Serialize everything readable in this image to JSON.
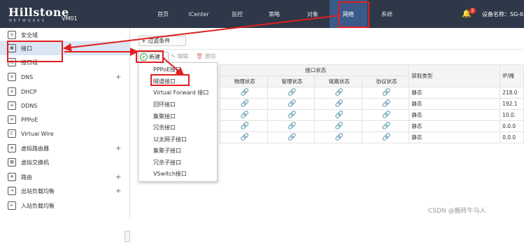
{
  "brand": {
    "logo": "Hillstone",
    "logo_sub": "NETWORKS",
    "device": "VM01"
  },
  "nav": [
    "首页",
    "iCenter",
    "监控",
    "策略",
    "对象",
    "网络",
    "系统"
  ],
  "notifications": {
    "count": "2"
  },
  "device_name": "设备名称：SG-6",
  "sidebar": [
    {
      "label": "安全域",
      "icon": "security-zone-icon",
      "plus": false
    },
    {
      "label": "接口",
      "icon": "interface-icon",
      "plus": false
    },
    {
      "label": "接口组",
      "icon": "interface-group-icon",
      "plus": false
    },
    {
      "label": "DNS",
      "icon": "dns-icon",
      "plus": true
    },
    {
      "label": "DHCP",
      "icon": "dhcp-icon",
      "plus": false
    },
    {
      "label": "DDNS",
      "icon": "ddns-icon",
      "plus": false
    },
    {
      "label": "PPPoE",
      "icon": "pppoe-icon",
      "plus": false
    },
    {
      "label": "Virtual Wire",
      "icon": "virtual-wire-icon",
      "plus": false
    },
    {
      "label": "虚拟路由器",
      "icon": "virtual-router-icon",
      "plus": true
    },
    {
      "label": "虚拟交换机",
      "icon": "virtual-switch-icon",
      "plus": false
    },
    {
      "label": "路由",
      "icon": "route-icon",
      "plus": true
    },
    {
      "label": "出站负载均衡",
      "icon": "outbound-lb-icon",
      "plus": true
    },
    {
      "label": "入站负载均衡",
      "icon": "inbound-lb-icon",
      "plus": false
    }
  ],
  "toolbar": {
    "filter": "过滤条件",
    "add": "新建",
    "edit": "编辑",
    "delete": "删除"
  },
  "table": {
    "group_header": "接口状态",
    "sub_headers": [
      "物理状态",
      "管理状态",
      "链路状态",
      "协议状态"
    ],
    "acquire_header": "获取类型",
    "ip_header": "IP/掩",
    "rows": [
      {
        "phys": "ok",
        "admin": "ok",
        "link": "ok",
        "proto": "ok",
        "acquire": "静态",
        "ip": "218.0"
      },
      {
        "phys": "ok",
        "admin": "ok",
        "link": "ok",
        "proto": "ok",
        "acquire": "静态",
        "ip": "192.1"
      },
      {
        "phys": "ok",
        "admin": "ok",
        "link": "ok",
        "proto": "ok",
        "acquire": "静态",
        "ip": "10.0."
      },
      {
        "phys": "ok",
        "admin": "ok",
        "link": "ok",
        "proto": "bad",
        "acquire": "静态",
        "ip": "0.0.0"
      },
      {
        "phys": "bad",
        "admin": "ok",
        "link": "bad",
        "proto": "bad",
        "acquire": "静态",
        "ip": "0.0.0"
      }
    ]
  },
  "dropdown": [
    "PPPoE接口",
    "隧道接口",
    "Virtual Forward 接口",
    "回环接口",
    "集聚接口",
    "冗余接口",
    "以太网子接口",
    "集聚子接口",
    "冗余子接口",
    "VSwitch接口"
  ],
  "colors": {
    "topbar": "#2e3848",
    "active_nav": "#3a5a8a",
    "annotation": "#e02020",
    "ok": "#3aaa3a",
    "bad": "#e04040"
  },
  "watermark": "CSDN @搬砖牛马人"
}
